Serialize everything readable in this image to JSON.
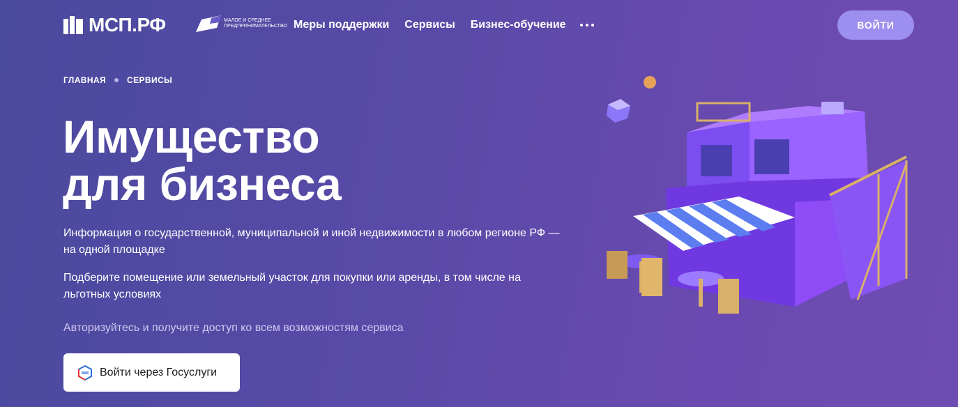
{
  "header": {
    "logo_text": "МСП.РФ",
    "partner_text": "Малое и среднее предпринимательство",
    "nav": [
      "Меры поддержки",
      "Сервисы",
      "Бизнес-обучение"
    ],
    "login_label": "ВОЙТИ"
  },
  "breadcrumb": [
    "ГЛАВНАЯ",
    "СЕРВИСЫ"
  ],
  "hero": {
    "title_line1": "Имущество",
    "title_line2": "для бизнеса",
    "desc1": "Информация о государственной, муниципальной и иной недвижимости в любом регионе РФ — на одной площадке",
    "desc2": "Подберите помещение или земельный участок для покупки или аренды, в том числе на льготных условиях",
    "auth_hint": "Авторизуйтесь и получите доступ ко всем возможностям сервиса",
    "gosuslugi_label": "Войти через Госуслуги"
  },
  "colors": {
    "bg_start": "#4a4a9e",
    "bg_end": "#6e4db2",
    "accent_button": "#9d8ff0"
  }
}
